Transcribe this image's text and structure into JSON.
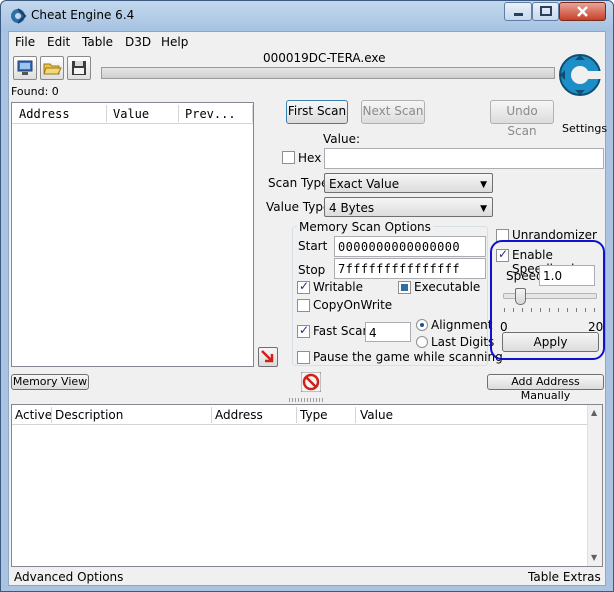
{
  "window": {
    "title": "Cheat Engine 6.4",
    "process_name": "000019DC-TERA.exe",
    "found_label": "Found: 0"
  },
  "menu": {
    "items": [
      "File",
      "Edit",
      "Table",
      "D3D",
      "Help"
    ]
  },
  "logo": {
    "settings_label": "Settings"
  },
  "address_list": {
    "columns": [
      "Address",
      "Value",
      "Prev..."
    ]
  },
  "scan": {
    "first_scan": "First Scan",
    "next_scan": "Next Scan",
    "undo_scan": "Undo Scan",
    "value_label": "Value:",
    "hex_label": "Hex",
    "hex_checked": false,
    "value": "",
    "scan_type_label": "Scan Type",
    "scan_type_value": "Exact Value",
    "value_type_label": "Value Type",
    "value_type_value": "4 Bytes"
  },
  "memory_options": {
    "title": "Memory Scan Options",
    "start_label": "Start",
    "start_value": "0000000000000000",
    "stop_label": "Stop",
    "stop_value": "7fffffffffffffff",
    "writable_label": "Writable",
    "writable_checked": true,
    "executable_label": "Executable",
    "executable_checked": "partial",
    "copyonwrite_label": "CopyOnWrite",
    "copyonwrite_checked": false,
    "fast_scan_label": "Fast Scan",
    "fast_scan_checked": true,
    "fast_scan_value": "4",
    "alignment_label": "Alignment",
    "alignment_selected": true,
    "last_digits_label": "Last Digits",
    "pause_label": "Pause the game while scanning",
    "pause_checked": false
  },
  "speedhack": {
    "unrandomizer_label": "Unrandomizer",
    "unrandomizer_checked": false,
    "enable_label": "Enable Speedhack",
    "enable_checked": true,
    "speed_label": "Speed",
    "speed_value": "1.0",
    "slider_min": "0",
    "slider_max": "20",
    "slider_value": 1,
    "apply_label": "Apply",
    "highlight_color": "#1010d0"
  },
  "buttons": {
    "memory_view": "Memory View",
    "add_address_manually": "Add Address Manually"
  },
  "cheat_table": {
    "columns": [
      "Active",
      "Description",
      "Address",
      "Type",
      "Value"
    ]
  },
  "footer": {
    "advanced_options": "Advanced Options",
    "table_extras": "Table Extras"
  }
}
